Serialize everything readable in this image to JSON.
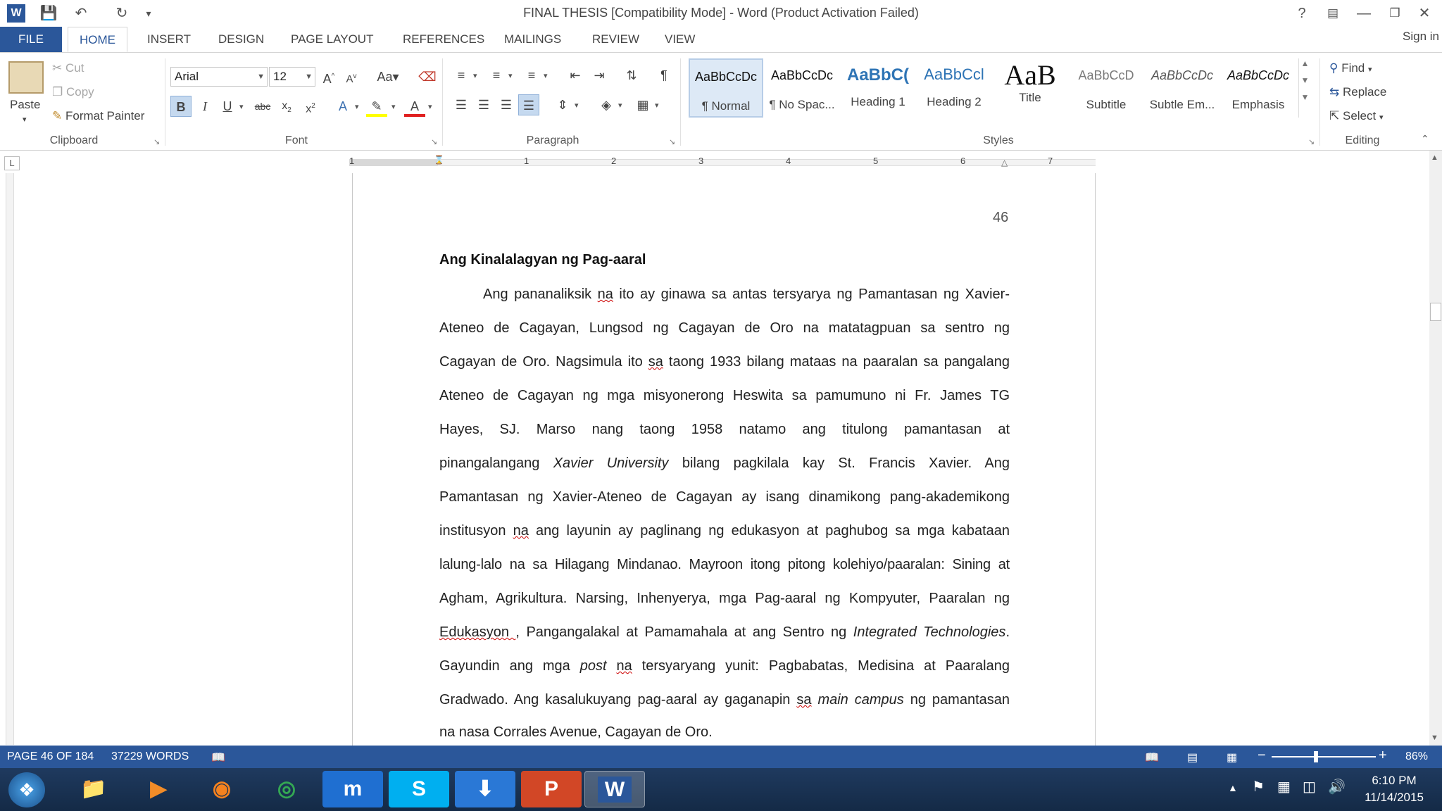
{
  "window": {
    "title": "FINAL THESIS [Compatibility Mode] - Word (Product Activation Failed)",
    "sign_in": "Sign in"
  },
  "tabs": [
    "FILE",
    "HOME",
    "INSERT",
    "DESIGN",
    "PAGE LAYOUT",
    "REFERENCES",
    "MAILINGS",
    "REVIEW",
    "VIEW"
  ],
  "ribbon": {
    "clipboard": {
      "paste": "Paste",
      "cut": "Cut",
      "copy": "Copy",
      "format_painter": "Format Painter",
      "label": "Clipboard"
    },
    "font": {
      "name": "Arial",
      "size": "12",
      "label": "Font"
    },
    "paragraph": {
      "label": "Paragraph"
    },
    "styles": {
      "label": "Styles",
      "items": [
        {
          "preview": "AaBbCcDc",
          "name": "¶ Normal"
        },
        {
          "preview": "AaBbCcDc",
          "name": "¶ No Spac..."
        },
        {
          "preview": "AaBbC(",
          "name": "Heading 1"
        },
        {
          "preview": "AaBbCcl",
          "name": "Heading 2"
        },
        {
          "preview": "AaB",
          "name": "Title"
        },
        {
          "preview": "AaBbCcD",
          "name": "Subtitle"
        },
        {
          "preview": "AaBbCcDc",
          "name": "Subtle Em..."
        },
        {
          "preview": "AaBbCcDc",
          "name": "Emphasis"
        }
      ]
    },
    "editing": {
      "find": "Find",
      "replace": "Replace",
      "select": "Select",
      "label": "Editing"
    }
  },
  "ruler": {
    "marks": [
      "1",
      "1",
      "2",
      "3",
      "4",
      "5",
      "6",
      "7"
    ]
  },
  "document": {
    "page_number": "46",
    "heading": "Ang Kinalalagyan ng Pag-aaral",
    "lines": [
      "Ang pananaliksik na ito ay ginawa sa antas tersyarya ng Pamantasan ng Xavier-",
      "Ateneo de Cagayan, Lungsod ng Cagayan de Oro na matatagpuan sa sentro ng",
      "Cagayan de Oro. Nagsimula ito sa taong 1933 bilang mataas na paaralan sa pangalang",
      "Ateneo de Cagayan ng mga misyonerong Heswita sa pamumuno ni Fr. James TG",
      "Hayes, SJ. Marso nang taong 1958 natamo ang titulong pamantasan at",
      "pinangalangang Xavier University bilang pagkilala kay St. Francis Xavier. Ang",
      "Pamantasan ng Xavier-Ateneo de Cagayan ay isang dinamikong pang-akademikong",
      "institusyon na ang layunin ay paglinang ng edukasyon at paghubog sa mga kabataan",
      "lalung-lalo na sa Hilagang Mindanao.  Mayroon itong pitong kolehiyo/paaralan: Sining at",
      "Agham, Agrikultura. Narsing, Inhenyerya, mga Pag-aaral ng Kompyuter, Paaralan ng",
      "Edukasyon , Pangangalakal at Pamamahala at ang Sentro ng Integrated Technologies.",
      "Gayundin ang mga post na tersyaryang yunit: Pagbabatas, Medisina at Paaralang",
      "Gradwado. Ang kasalukuyang pag-aaral ay gaganapin sa main campus ng pamantasan",
      "na nasa Corrales Avenue, Cagayan de Oro."
    ]
  },
  "status": {
    "page": "PAGE 46 OF 184",
    "words": "37229 WORDS",
    "zoom": "86%"
  },
  "taskbar": {
    "time": "6:10 PM",
    "date": "11/14/2015"
  },
  "colors": {
    "accent": "#2b579a"
  }
}
